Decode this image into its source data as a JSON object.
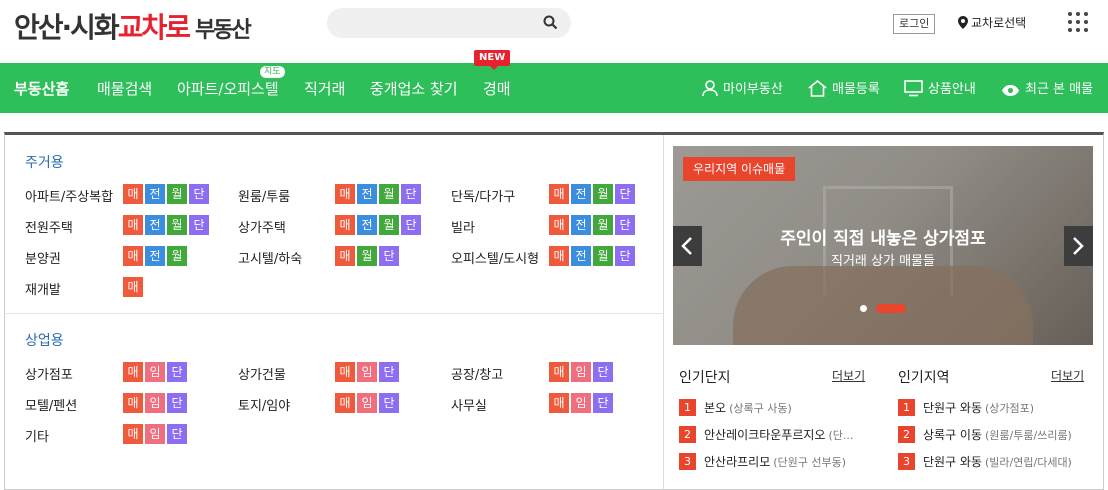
{
  "header": {
    "logo_part1": "안산·시화",
    "logo_part2": "교차로",
    "logo_part3": "부동산",
    "search_placeholder": "",
    "login_label": "로그인",
    "region_label": "교차로선택"
  },
  "nav": {
    "left": [
      "부동산홈",
      "매물검색",
      "아파트/오피스텔",
      "직거래",
      "중개업소 찾기",
      "경매"
    ],
    "badge_jido": "지도",
    "badge_new": "NEW",
    "right": [
      "마이부동산",
      "매물등록",
      "상품안내",
      "최근 본 매물"
    ]
  },
  "residential": {
    "title": "주거용",
    "rows": [
      {
        "label": "아파트/주상복합",
        "tags": [
          "매",
          "전",
          "월",
          "단"
        ]
      },
      {
        "label": "원룸/투룸",
        "tags": [
          "매",
          "전",
          "월",
          "단"
        ]
      },
      {
        "label": "단독/다가구",
        "tags": [
          "매",
          "전",
          "월",
          "단"
        ]
      },
      {
        "label": "전원주택",
        "tags": [
          "매",
          "전",
          "월",
          "단"
        ]
      },
      {
        "label": "상가주택",
        "tags": [
          "매",
          "전",
          "월",
          "단"
        ]
      },
      {
        "label": "빌라",
        "tags": [
          "매",
          "전",
          "월",
          "단"
        ]
      },
      {
        "label": "분양권",
        "tags": [
          "매",
          "전",
          "월"
        ]
      },
      {
        "label": "고시텔/하숙",
        "tags": [
          "매",
          "월",
          "단"
        ]
      },
      {
        "label": "오피스텔/도시형",
        "tags": [
          "매",
          "전",
          "월",
          "단"
        ]
      },
      {
        "label": "재개발",
        "tags": [
          "매"
        ]
      }
    ]
  },
  "commercial": {
    "title": "상업용",
    "rows": [
      {
        "label": "상가점포",
        "tags": [
          "매",
          "임",
          "단"
        ]
      },
      {
        "label": "상가건물",
        "tags": [
          "매",
          "임",
          "단"
        ]
      },
      {
        "label": "공장/창고",
        "tags": [
          "매",
          "임",
          "단"
        ]
      },
      {
        "label": "모텔/펜션",
        "tags": [
          "매",
          "임",
          "단"
        ]
      },
      {
        "label": "토지/임야",
        "tags": [
          "매",
          "임",
          "단"
        ]
      },
      {
        "label": "사무실",
        "tags": [
          "매",
          "임",
          "단"
        ]
      },
      {
        "label": "기타",
        "tags": [
          "매",
          "임",
          "단"
        ]
      }
    ]
  },
  "banner": {
    "tag": "우리지역 이슈매물",
    "title": "주인이 직접 내놓은 상가점포",
    "subtitle": "직거래 상가 매물들"
  },
  "popular_complex": {
    "title": "인기단지",
    "more": "더보기",
    "items": [
      {
        "rank": "1",
        "name": "본오",
        "sub": "(상록구 사동)"
      },
      {
        "rank": "2",
        "name": "안산레이크타운푸르지오",
        "sub": "(단..."
      },
      {
        "rank": "3",
        "name": "안산라프리모",
        "sub": "(단원구 선부동)"
      }
    ]
  },
  "popular_region": {
    "title": "인기지역",
    "more": "더보기",
    "items": [
      {
        "rank": "1",
        "name": "단원구 와동",
        "sub": "(상가점포)"
      },
      {
        "rank": "2",
        "name": "상록구 이동",
        "sub": "(원룸/투룸/쓰리룸)"
      },
      {
        "rank": "3",
        "name": "단원구 와동",
        "sub": "(빌라/연립/다세대)"
      }
    ]
  },
  "colors": {
    "brand_green": "#2ebf5b",
    "brand_red": "#e8212f",
    "tag_sale": "#ef5a3c",
    "tag_jeonse": "#3b8ede",
    "tag_monthly": "#41a83b",
    "tag_short": "#8e6ef0",
    "tag_rent": "#f16e7e"
  }
}
